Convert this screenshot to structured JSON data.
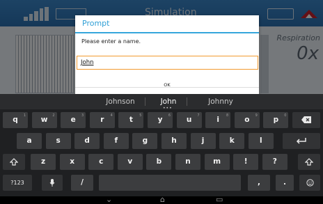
{
  "app": {
    "title": "Simulation",
    "respiration_label": "Respiration",
    "respiration_value": "0x"
  },
  "dialog": {
    "title": "Prompt",
    "message": "Please enter a name.",
    "input_value": "John",
    "ok_label": "OK"
  },
  "suggestions": [
    "Johnson",
    "John",
    "Johnny"
  ],
  "keyboard": {
    "row1": [
      {
        "k": "q",
        "h": "1"
      },
      {
        "k": "w",
        "h": "2"
      },
      {
        "k": "e",
        "h": "3"
      },
      {
        "k": "r",
        "h": "4"
      },
      {
        "k": "t",
        "h": "5"
      },
      {
        "k": "y",
        "h": "6"
      },
      {
        "k": "u",
        "h": "7"
      },
      {
        "k": "i",
        "h": "8"
      },
      {
        "k": "o",
        "h": "9"
      },
      {
        "k": "p",
        "h": "0"
      }
    ],
    "row2": [
      "a",
      "s",
      "d",
      "f",
      "g",
      "h",
      "j",
      "k",
      "l"
    ],
    "row3": [
      "z",
      "x",
      "c",
      "v",
      "b",
      "n",
      "m",
      "!",
      "?"
    ],
    "symbols_label": "?123",
    "comma": ",",
    "period": ".",
    "slash": "/"
  },
  "icons": [
    "backspace-icon",
    "enter-icon",
    "shift-icon",
    "mic-icon",
    "emoji-icon",
    "back-icon",
    "home-icon",
    "recents-icon"
  ]
}
